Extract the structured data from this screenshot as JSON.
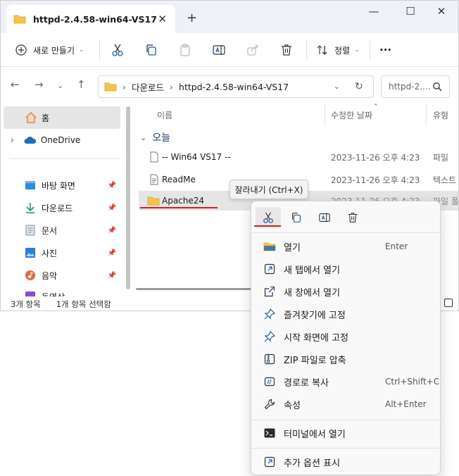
{
  "window": {
    "tab_title": "httpd-2.4.58-win64-VS17",
    "close_tab": "✕",
    "new_tab": "+",
    "minimize": "—",
    "maximize": "☐",
    "close": "✕"
  },
  "toolbar": {
    "new_label": "새로 만들기",
    "sort_label": "정렬",
    "more_label": "···"
  },
  "address": {
    "crumbs": [
      "다운로드",
      "httpd-2.4.58-win64-VS17"
    ],
    "search_placeholder": "httpd-2...."
  },
  "sidebar": {
    "items": [
      {
        "label": "홈"
      },
      {
        "label": "OneDrive"
      },
      {
        "label": "바탕 화면"
      },
      {
        "label": "다운로드"
      },
      {
        "label": "문서"
      },
      {
        "label": "사진"
      },
      {
        "label": "음악"
      },
      {
        "label": "동영상"
      }
    ]
  },
  "content": {
    "headers": {
      "name": "이름",
      "modified": "수정한 날짜",
      "type": "유형"
    },
    "group": "오늘",
    "rows": [
      {
        "name": "-- Win64 VS17  --",
        "modified": "2023-11-26 오후 4:23",
        "type": "파일"
      },
      {
        "name": "ReadMe",
        "modified": "2023-11-26 오후 4:23",
        "type": "텍스트"
      },
      {
        "name": "Apache24",
        "modified": "2023-11-26 오후 4:23",
        "type": "파일 폴"
      }
    ]
  },
  "status": {
    "count": "3개 항목",
    "selected": "1개 항목 선택함"
  },
  "tooltip": "잘라내기 (Ctrl+X)",
  "context_menu": {
    "items": [
      {
        "label": "열기",
        "shortcut": "Enter"
      },
      {
        "label": "새 탭에서 열기",
        "shortcut": ""
      },
      {
        "label": "새 창에서 열기",
        "shortcut": ""
      },
      {
        "label": "즐겨찾기에 고정",
        "shortcut": ""
      },
      {
        "label": "시작 화면에 고정",
        "shortcut": ""
      },
      {
        "label": "ZIP 파일로 압축",
        "shortcut": ""
      },
      {
        "label": "경로로 복사",
        "shortcut": "Ctrl+Shift+C"
      },
      {
        "label": "속성",
        "shortcut": "Alt+Enter"
      },
      {
        "label": "터미널에서 열기",
        "shortcut": ""
      },
      {
        "label": "추가 옵션 표시",
        "shortcut": ""
      }
    ]
  },
  "colors": {
    "accent": "#0067c0",
    "folder": "#f3c64b",
    "highlight_line": "#d81e1e"
  }
}
